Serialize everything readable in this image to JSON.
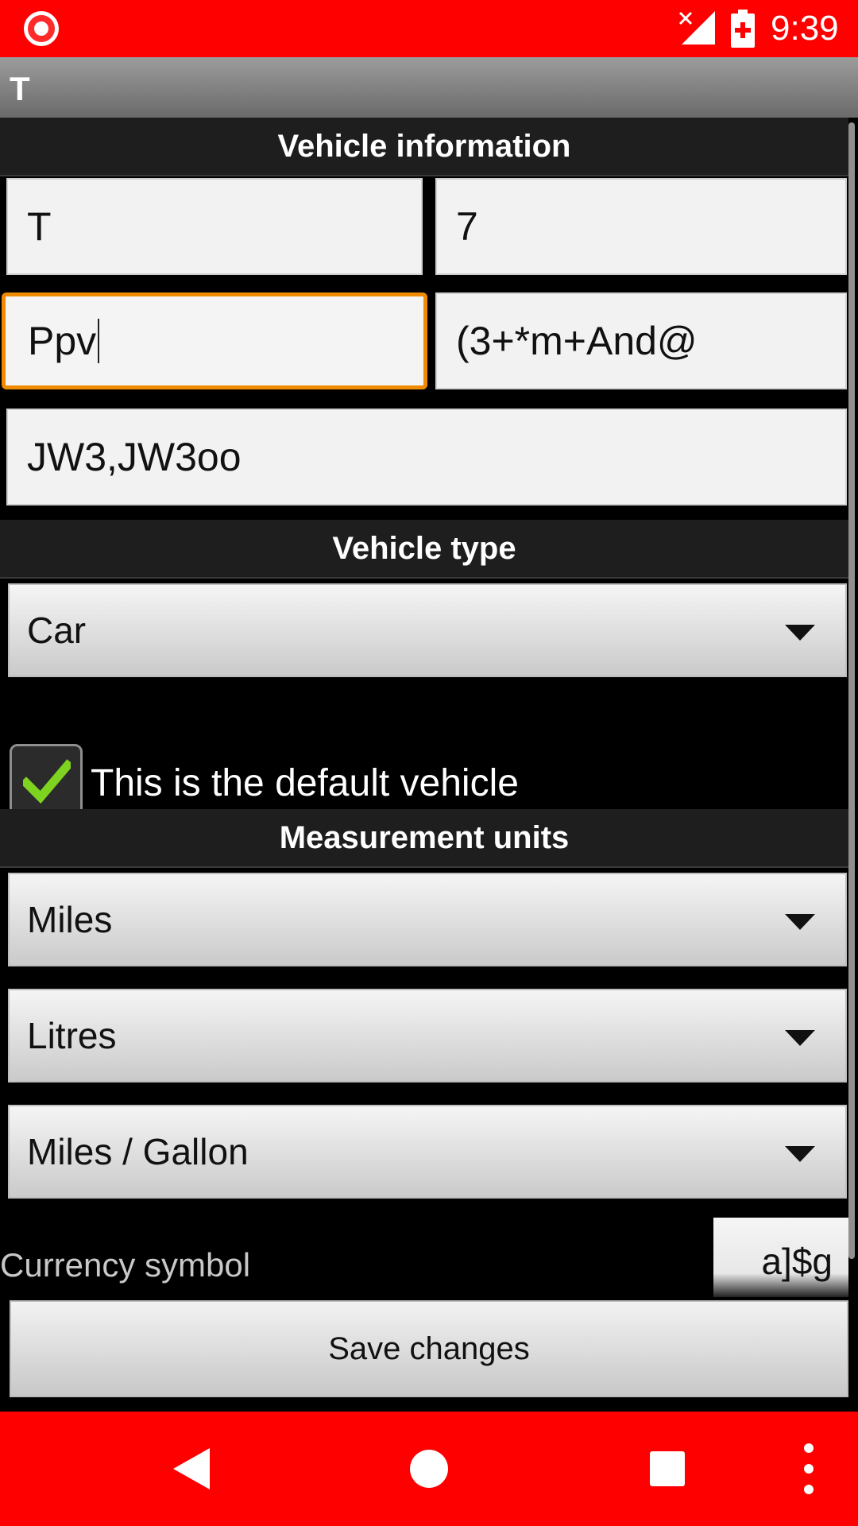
{
  "status_bar": {
    "time": "9:39"
  },
  "title_bar": {
    "title": "T"
  },
  "sections": {
    "vehicle_information": "Vehicle information",
    "vehicle_type": "Vehicle type",
    "measurement_units": "Measurement units"
  },
  "fields": {
    "field_1": "T",
    "field_2": "7",
    "field_3": "Ppv",
    "field_4": "(3+*m+And@",
    "field_5": "JW3,JW3oo"
  },
  "vehicle_type": {
    "selected": "Car"
  },
  "default_vehicle": {
    "label": "This is the default vehicle",
    "checked": true
  },
  "units": {
    "distance": "Miles",
    "volume": "Litres",
    "consumption": "Miles / Gallon"
  },
  "currency": {
    "label": "Currency symbol",
    "value": "a]$g"
  },
  "save_button": {
    "label": "Save changes"
  },
  "colors": {
    "status_bar": "#ff0000",
    "nav_bar": "#ff0000",
    "focus_accent": "#f08a00",
    "check_mark": "#7ed321"
  },
  "icons": [
    "record-icon",
    "no-signal-icon",
    "battery-charging-icon",
    "check-icon",
    "dropdown-arrow-icon",
    "back-icon",
    "home-icon",
    "recents-icon",
    "more-icon"
  ]
}
